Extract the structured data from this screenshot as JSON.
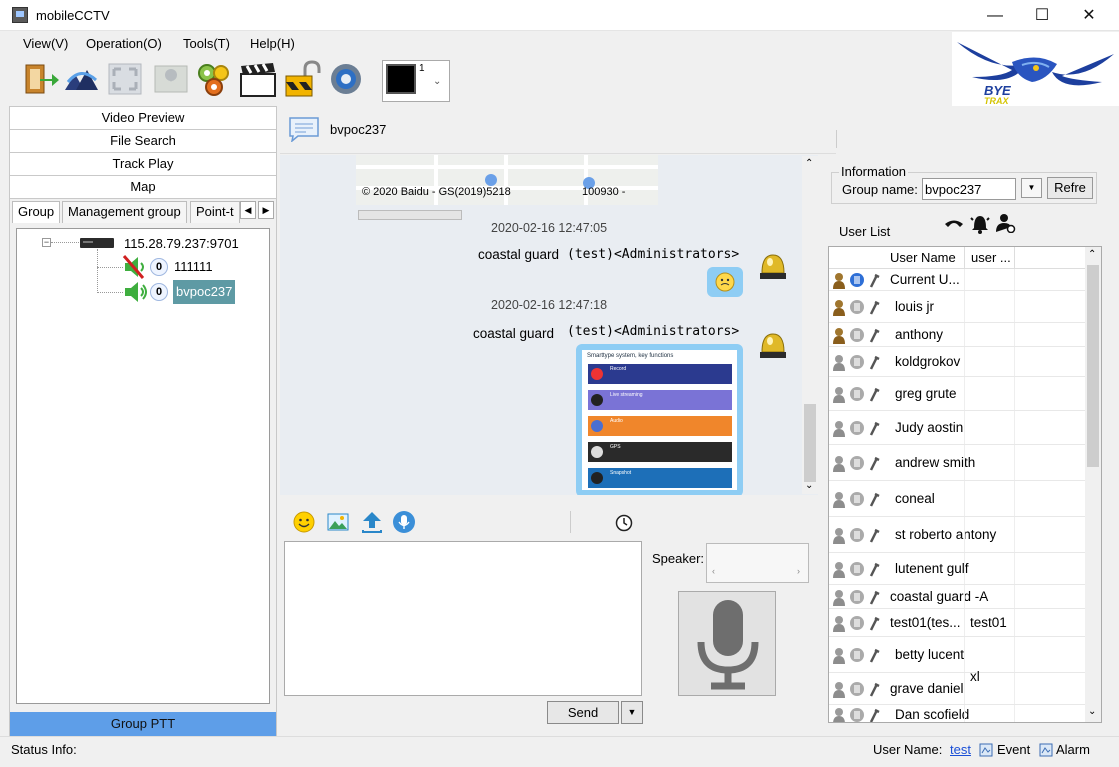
{
  "window": {
    "title": "mobileCCTV",
    "minimize": "—",
    "maximize": "☐",
    "close": "✕"
  },
  "menu": [
    "View(V)",
    "Operation(O)",
    "Tools(T)",
    "Help(H)"
  ],
  "toolbar": {
    "icons": [
      "exit-icon",
      "network-icon",
      "fullscreen-icon",
      "map-icon",
      "settings-gears-icon",
      "clapperboard-icon",
      "unlock-icon",
      "gear-settings-icon"
    ],
    "screen_count": "1"
  },
  "logo": {
    "text": "BYE TRAX"
  },
  "left_nav": {
    "buttons": [
      "Video Preview",
      "File Search",
      "Track Play",
      "Map"
    ],
    "tabs": [
      "Group",
      "Management group",
      "Point-t"
    ],
    "tree": {
      "root": "115.28.79.237:9701",
      "children": [
        {
          "count": "0",
          "label": "111111"
        },
        {
          "count": "0",
          "label": "bvpoc237"
        }
      ]
    },
    "group_ptt": "Group PTT"
  },
  "chat": {
    "header_title": "bvpoc237",
    "map_attribution": "© 2020 Baidu - GS(2019)5218",
    "map_code": "100930 -",
    "messages": [
      {
        "time": "2020-02-16 12:47:05",
        "sender": "coastal guard",
        "role": "(test)<Administrators>",
        "content": "emoji"
      },
      {
        "time": "2020-02-16 12:47:18",
        "sender": "coastal guard",
        "role": "(test)<Administrators>",
        "content": "image"
      }
    ],
    "image_card": {
      "title": "Smarttype system, key functions",
      "rows": [
        {
          "heading": "Record",
          "color": "#2b3a8f"
        },
        {
          "heading": "Live streaming",
          "color": "#7a73d6"
        },
        {
          "heading": "Audio",
          "color": "#f0862b"
        },
        {
          "heading": "GPS",
          "color": "#2a2a2a"
        },
        {
          "heading": "Snapshot",
          "color": "#1d6fb8"
        }
      ]
    },
    "send_label": "Send",
    "speaker_label": "Speaker:"
  },
  "info": {
    "section_title": "Information",
    "group_name_label": "Group name:",
    "group_name_value": "bvpoc237",
    "refresh_label": "Refre",
    "user_list_label": "User List",
    "columns": [
      "User Name",
      "user ..."
    ],
    "users": [
      {
        "name": "Current U...",
        "extra": ""
      },
      {
        "name": "louis jr",
        "extra": ""
      },
      {
        "name": "anthony",
        "extra": ""
      },
      {
        "name": "koldgrokov",
        "extra": ""
      },
      {
        "name": "greg grute",
        "extra": ""
      },
      {
        "name": "Judy aostin",
        "extra": ""
      },
      {
        "name": "andrew smith",
        "extra": ""
      },
      {
        "name": "coneal",
        "extra": ""
      },
      {
        "name": "st roberto antony",
        "extra": ""
      },
      {
        "name": "lutenent gulf",
        "extra": ""
      },
      {
        "name": "coastal guard -A",
        "extra": ""
      },
      {
        "name": "test01(tes...",
        "extra": "test01"
      },
      {
        "name": "betty lucent",
        "extra": "xl"
      },
      {
        "name": "grave daniel",
        "extra": ""
      },
      {
        "name": "Dan scofield",
        "extra": ""
      }
    ]
  },
  "status": {
    "info_label": "Status Info:",
    "user_name_label": "User Name:",
    "user_name_value": "test",
    "event_label": "Event",
    "alarm_label": "Alarm"
  },
  "colors": {
    "accent": "#5e9ee8",
    "chat_bg": "#e9edf2",
    "tree_bg": "#ffffff"
  }
}
